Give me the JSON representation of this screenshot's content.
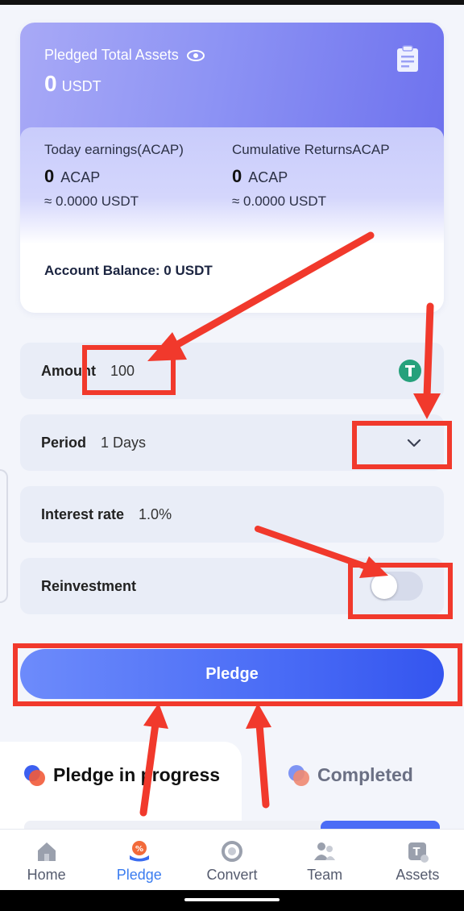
{
  "hero": {
    "total_label": "Pledged Total Assets",
    "total_value": "0",
    "total_unit": "USDT",
    "today_label": "Today earnings(ACAP)",
    "today_value": "0",
    "today_unit": "ACAP",
    "today_approx": "≈ 0.0000 USDT",
    "cumulative_label": "Cumulative ReturnsACAP",
    "cumulative_value": "0",
    "cumulative_unit": "ACAP",
    "cumulative_approx": "≈ 0.0000 USDT",
    "balance": "Account Balance: 0 USDT"
  },
  "form": {
    "amount_label": "Amount",
    "amount_value": "100",
    "period_label": "Period",
    "period_value": "1 Days",
    "interest_label": "Interest rate",
    "interest_value": "1.0%",
    "reinvest_label": "Reinvestment",
    "reinvest_on": false
  },
  "pledge_button": "Pledge",
  "tabs": [
    {
      "label": "Pledge in progress",
      "active": true
    },
    {
      "label": "Completed",
      "active": false
    }
  ],
  "nav": [
    {
      "label": "Home",
      "icon": "home-icon",
      "active": false
    },
    {
      "label": "Pledge",
      "icon": "pledge-icon",
      "active": true
    },
    {
      "label": "Convert",
      "icon": "convert-icon",
      "active": false
    },
    {
      "label": "Team",
      "icon": "team-icon",
      "active": false
    },
    {
      "label": "Assets",
      "icon": "assets-icon",
      "active": false
    }
  ],
  "colors": {
    "accent": "#4a6cf6",
    "annotation": "#f1392c",
    "usdt": "#26a17b"
  }
}
